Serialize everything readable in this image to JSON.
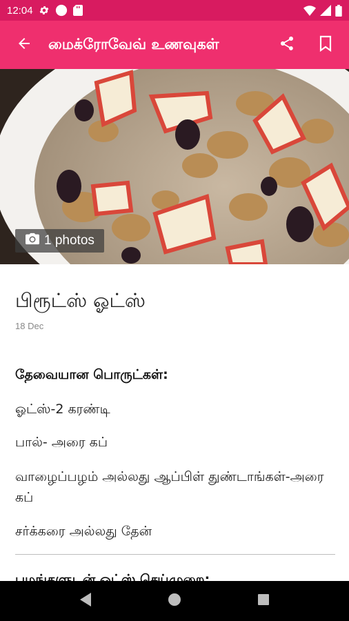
{
  "status_bar": {
    "time": "12:04",
    "icons": [
      "gear-icon",
      "circle-icon",
      "sd-card-icon",
      "wifi-icon",
      "signal-icon",
      "battery-icon"
    ]
  },
  "app_bar": {
    "title": "மைக்ரோவேவ் உணவுகள்",
    "back_icon": "arrow-back-icon",
    "share_icon": "share-icon",
    "bookmark_icon": "bookmark-icon"
  },
  "hero": {
    "photo_count_label": "1 photos",
    "camera_icon": "camera-icon"
  },
  "article": {
    "title": "பிரூட்ஸ் ஓட்ஸ்",
    "date": "18 Dec",
    "ingredients_heading": "தேவையான பொருட்கள்:",
    "ingredients": [
      "ஓட்ஸ்-2 கரண்டி",
      "பால்- அரை கப்",
      "வாழைப்பழம் அல்லது ஆப்பிள் துண்டாங்கள்-அரை கப்",
      "சர்க்கரை அல்லது தேன்"
    ],
    "next_heading": "பழங்களுடன் ஓட்ஸ் செய்முறை:"
  },
  "colors": {
    "status_bar": "#d81b60",
    "app_bar": "#ef2f6e"
  },
  "nav_bar": {
    "icons": [
      "back-triangle-icon",
      "home-circle-icon",
      "recents-square-icon"
    ]
  }
}
